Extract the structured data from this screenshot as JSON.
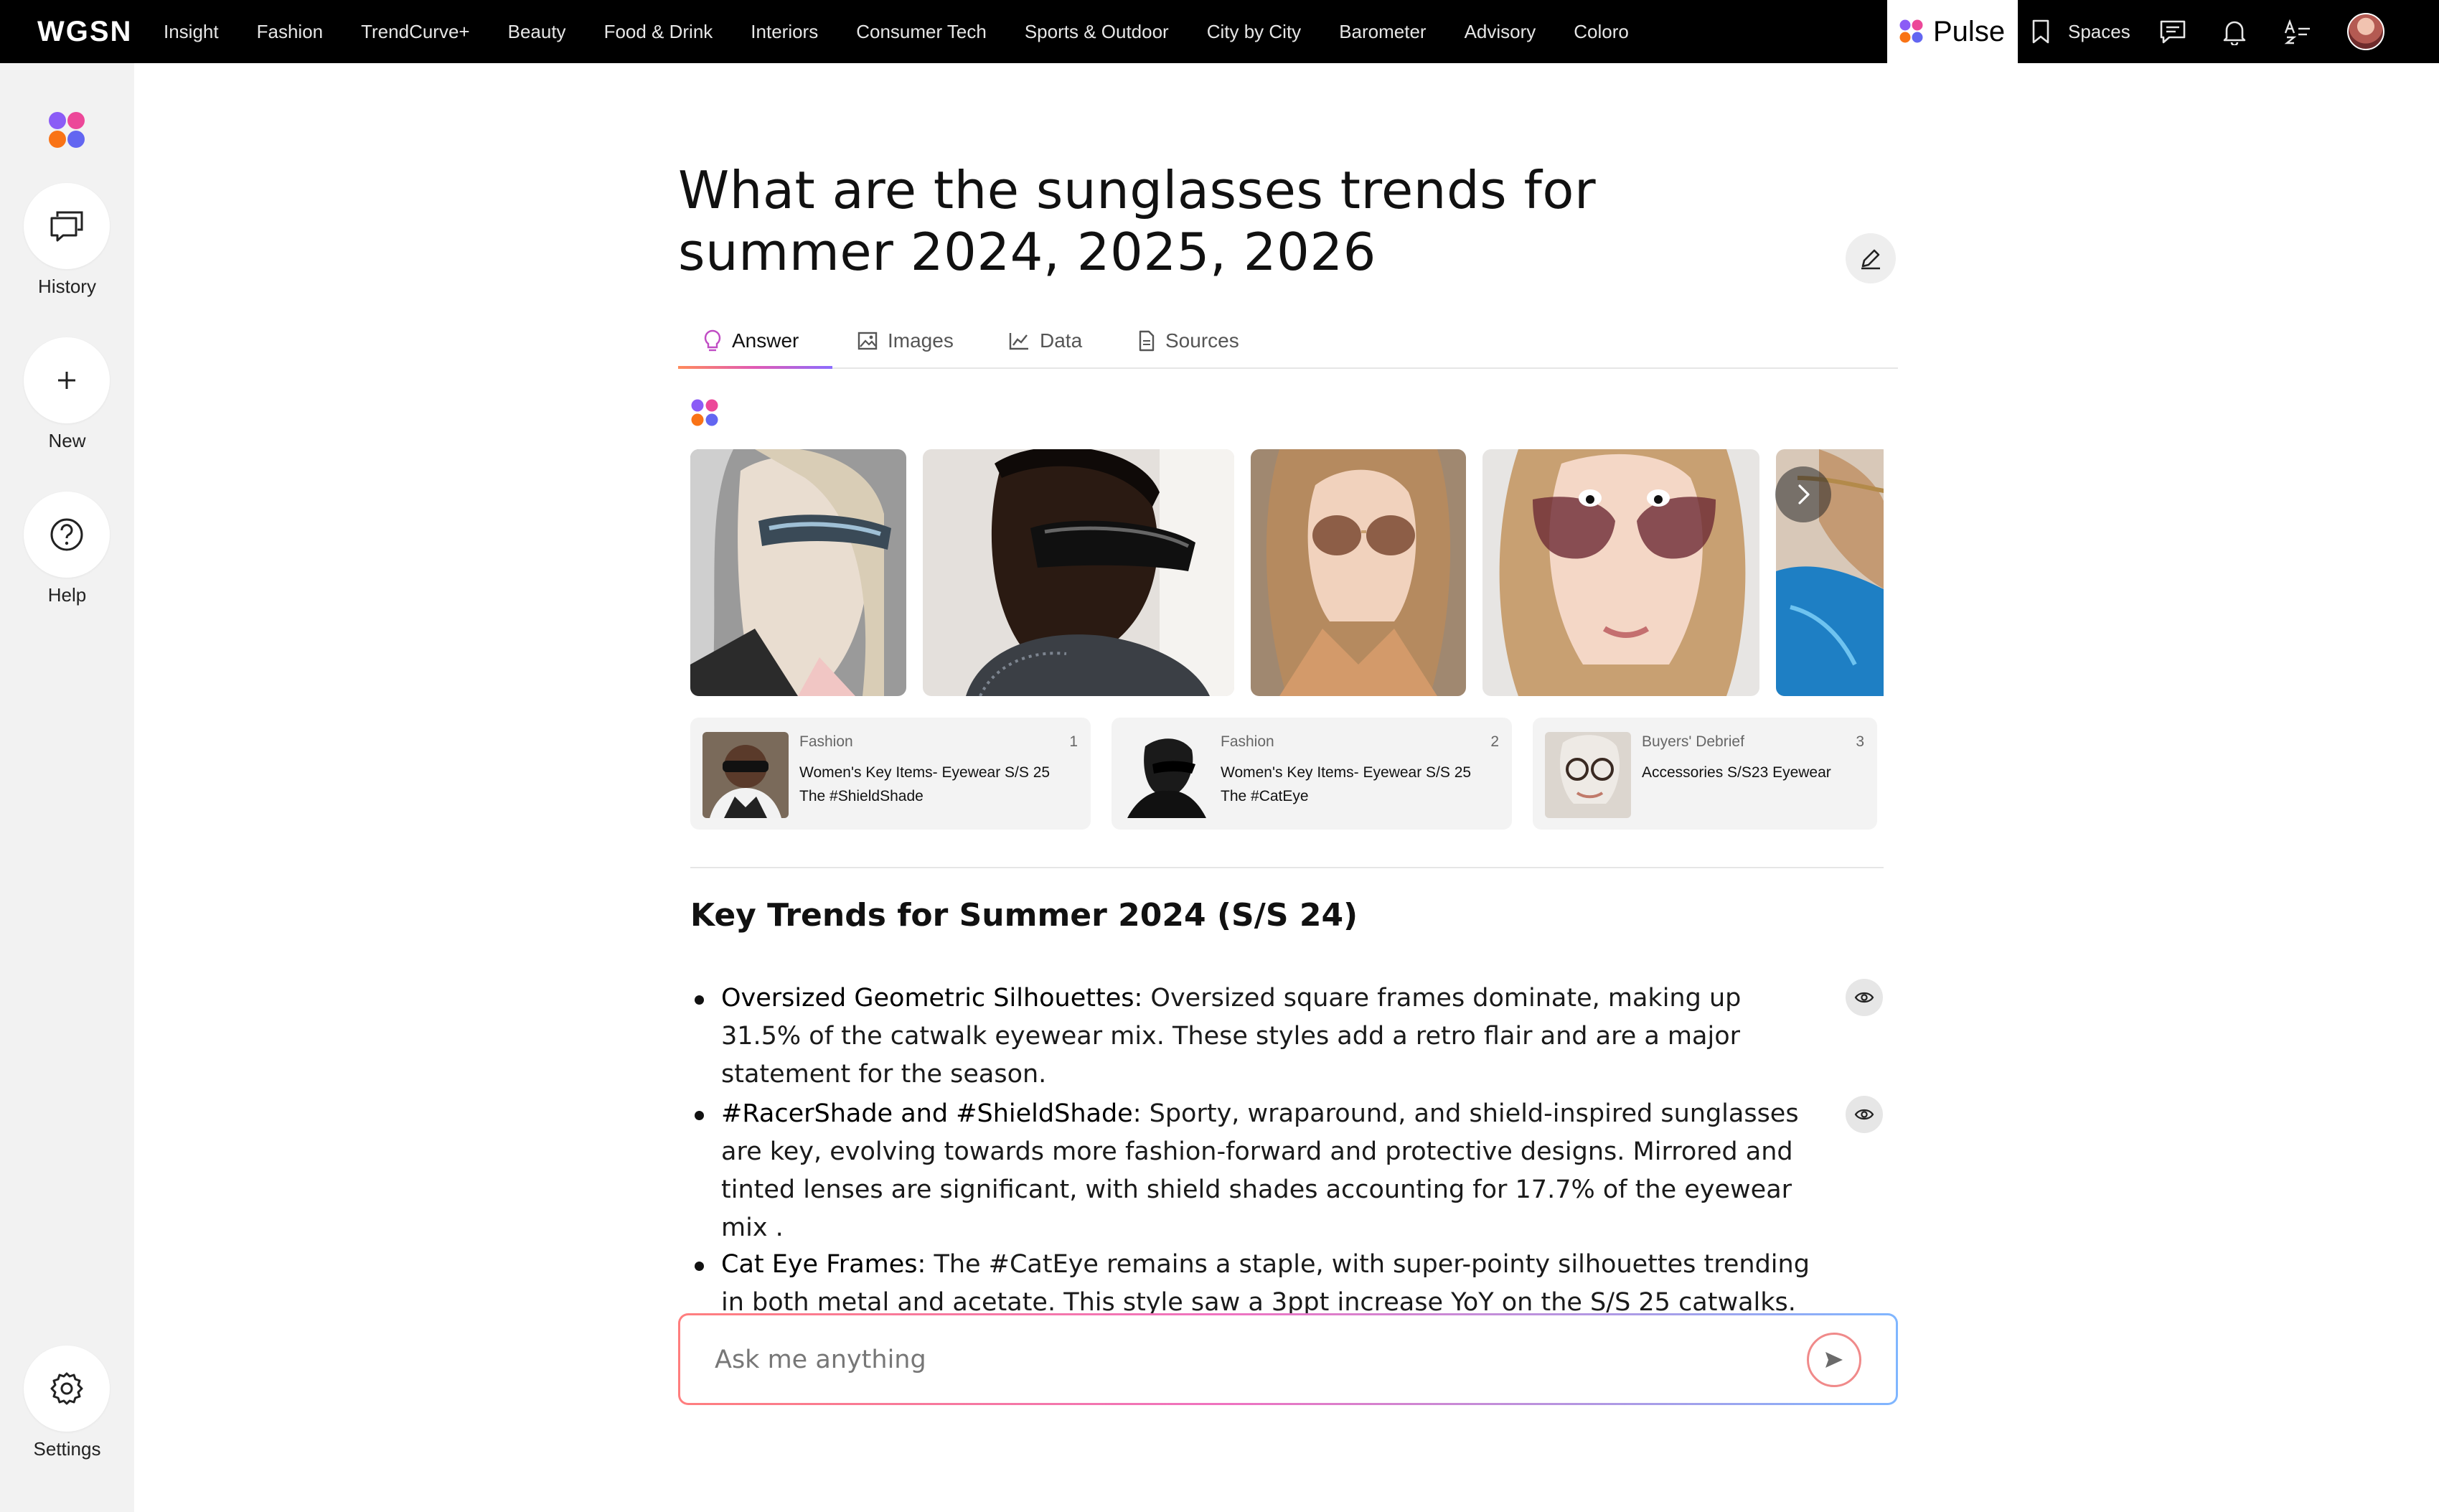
{
  "topnav": {
    "logo": "WGSN",
    "items": [
      "Insight",
      "Fashion",
      "TrendCurve+",
      "Beauty",
      "Food & Drink",
      "Interiors",
      "Consumer Tech",
      "Sports & Outdoor",
      "City by City",
      "Barometer",
      "Advisory",
      "Coloro"
    ],
    "pulse_label": "Pulse",
    "spaces_label": "Spaces"
  },
  "sidebar": {
    "history_label": "History",
    "new_label": "New",
    "help_label": "Help",
    "settings_label": "Settings"
  },
  "main": {
    "question": "What are the sunglasses trends for summer 2024, 2025, 2026",
    "tabs": [
      {
        "label": "Answer",
        "icon": "bulb-icon",
        "active": true
      },
      {
        "label": "Images",
        "icon": "image-icon"
      },
      {
        "label": "Data",
        "icon": "chart-icon"
      },
      {
        "label": "Sources",
        "icon": "document-icon"
      }
    ],
    "sources": [
      {
        "category": "Fashion",
        "number": "1",
        "title": "Women's Key Items- Eyewear S/S 25 The #ShieldShade"
      },
      {
        "category": "Fashion",
        "number": "2",
        "title": "Women's Key Items- Eyewear S/S 25 The #CatEye"
      },
      {
        "category": "Buyers' Debrief",
        "number": "3",
        "title": "Accessories S/S23 Eyewear"
      }
    ],
    "section_title": "Key Trends for Summer 2024 (S/S 24)",
    "bullets": [
      {
        "lead": "Oversized Geometric Silhouettes:",
        "text": " Oversized square frames dominate, making up 31.5% of the catwalk eyewear mix. These styles add a retro flair and are a major statement for the season."
      },
      {
        "lead": "#RacerShade and #ShieldShade:",
        "text": " Sporty, wraparound, and shield-inspired sunglasses are key, evolving towards more fashion-forward and protective designs. Mirrored and tinted lenses are significant, with shield shades accounting for 17.7% of the eyewear mix ."
      },
      {
        "lead": "Cat Eye Frames:",
        "text": " The #CatEye remains a staple, with super-pointy silhouettes trending in both metal and acetate. This style saw a 3ppt increase YoY on the S/S 25 catwalks."
      }
    ],
    "ask_placeholder": "Ask me anything"
  },
  "colors": {
    "nav_bg": "#000000",
    "sidebar_bg": "#f2f2f2",
    "brand_dots": [
      "#8b5cf6",
      "#ec4899",
      "#f97316",
      "#6366f1"
    ],
    "accent_gradient": [
      "#ff8a5b",
      "#e05ab5",
      "#8b6cff"
    ]
  }
}
